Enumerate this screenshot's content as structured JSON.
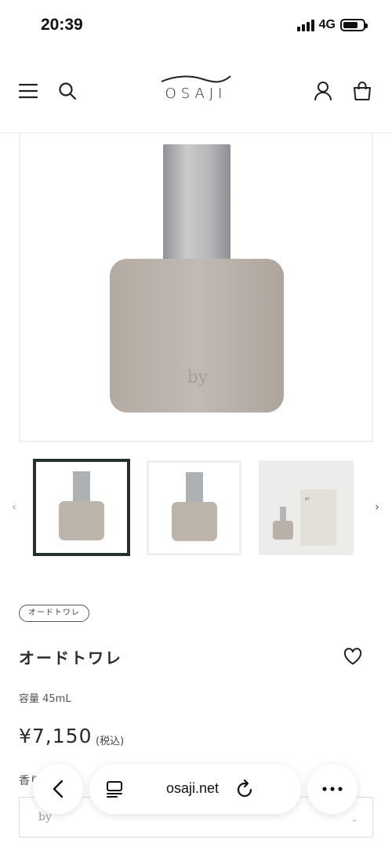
{
  "status": {
    "time": "20:39",
    "network": "4G"
  },
  "header": {
    "logo": "OSAJI"
  },
  "product": {
    "category": "オードトワレ",
    "title": "オードトワレ",
    "capacity": "容量 45mL",
    "price": "¥7,150",
    "tax": "(税込)",
    "bottle_mark": "by",
    "box_mark": "BY"
  },
  "options": {
    "scent_label": "香り",
    "scent_value": "by"
  },
  "browser": {
    "url": "osaji.net"
  },
  "colors": {
    "bottle": "#bdb4ac",
    "cap": "#a9acae",
    "selected_thumb_border": "#24312a"
  }
}
